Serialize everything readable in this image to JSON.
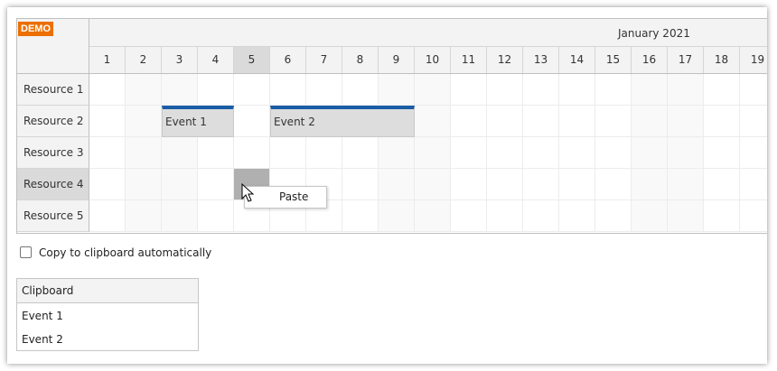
{
  "badge": "DEMO",
  "timeline": {
    "month": "January 2021",
    "days": [
      "1",
      "2",
      "3",
      "4",
      "5",
      "6",
      "7",
      "8",
      "9",
      "10",
      "11",
      "12",
      "13",
      "14",
      "15",
      "16",
      "17",
      "18",
      "19"
    ],
    "selected_day": "5"
  },
  "resources": [
    {
      "name": "Resource 1",
      "selected": false
    },
    {
      "name": "Resource 2",
      "selected": false
    },
    {
      "name": "Resource 3",
      "selected": false
    },
    {
      "name": "Resource 4",
      "selected": true
    },
    {
      "name": "Resource 5",
      "selected": false
    }
  ],
  "events": [
    {
      "label": "Event 1",
      "resource": "Resource 2",
      "start_day": "3",
      "end_day": "4"
    },
    {
      "label": "Event 2",
      "resource": "Resource 2",
      "start_day": "6",
      "end_day": "9"
    }
  ],
  "selected_cell": {
    "resource": "Resource 4",
    "day": "5"
  },
  "context_menu": {
    "items": [
      "Paste"
    ]
  },
  "copy_option": {
    "label": "Copy to clipboard automatically",
    "checked": false
  },
  "clipboard": {
    "title": "Clipboard",
    "items": [
      "Event 1",
      "Event 2"
    ]
  },
  "colors": {
    "accent": "#1a5da6",
    "badge": "#ec6f00",
    "selection": "#b0b0b0",
    "header_bg": "#f3f3f3"
  },
  "icons": {
    "cursor": "mouse-pointer-icon",
    "checkbox": "checkbox-unchecked-icon"
  }
}
